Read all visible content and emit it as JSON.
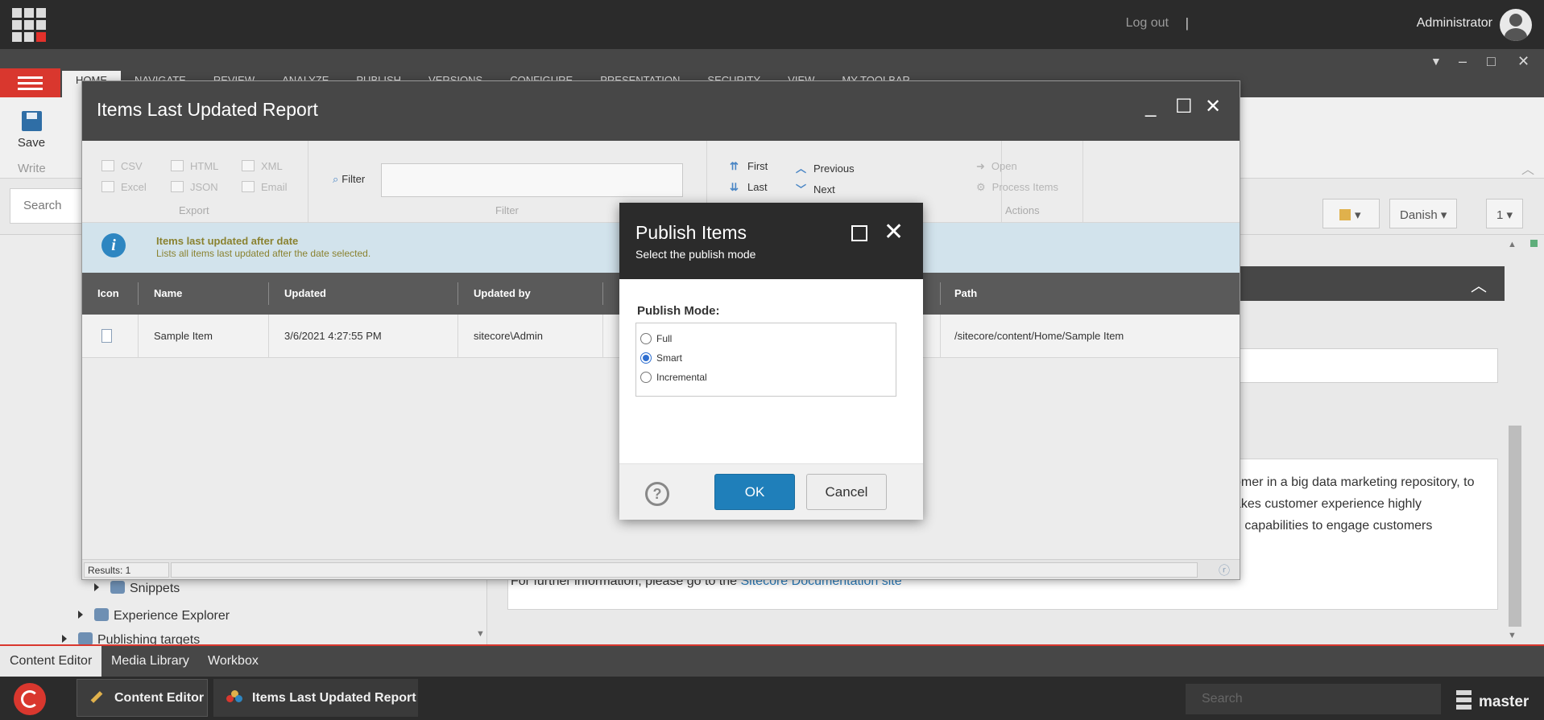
{
  "header": {
    "logout": "Log out",
    "separator": "|",
    "user": "Administrator"
  },
  "ribbon": {
    "tabs": [
      "HOME",
      "NAVIGATE",
      "REVIEW",
      "ANALYZE",
      "PUBLISH",
      "VERSIONS",
      "CONFIGURE",
      "PRESENTATION",
      "SECURITY",
      "VIEW",
      "MY TOOLBAR"
    ],
    "save_label": "Save",
    "write_label": "Write"
  },
  "search_row": {
    "search_placeholder": "Search",
    "language": "Danish",
    "version": "1"
  },
  "tree": {
    "items": [
      "Snippets",
      "Experience Explorer",
      "Publishing targets"
    ]
  },
  "content": {
    "line1": "omer in a big data marketing repository, to",
    "line2": "akes customer experience highly",
    "line3": "n capabilities to engage customers",
    "further_prefix": "For further information, please go to the",
    "link": "Sitecore Documentation site"
  },
  "bottom_tabs": [
    "Content Editor",
    "Media Library",
    "Workbox"
  ],
  "taskbar": {
    "tasks": [
      "Content Editor",
      "Items Last Updated Report"
    ],
    "search_placeholder": "Search",
    "database": "master"
  },
  "report": {
    "title": "Items Last Updated Report",
    "export": {
      "items": [
        "CSV",
        "HTML",
        "XML",
        "Excel",
        "JSON",
        "Email"
      ],
      "label": "Export"
    },
    "filter": {
      "label": "Filter",
      "group_label": "Filter",
      "value": ""
    },
    "navigation": {
      "first": "First",
      "previous": "Previous",
      "last": "Last",
      "next": "Next"
    },
    "actions": {
      "open": "Open",
      "process": "Process Items",
      "label": "Actions"
    },
    "info": {
      "title": "Items last updated after date",
      "description": "Lists all items last updated after the date selected."
    },
    "columns": [
      "Icon",
      "Name",
      "Updated",
      "Updated by",
      "Path"
    ],
    "rows": [
      {
        "name": "Sample Item",
        "updated": "3/6/2021 4:27:55 PM",
        "updated_by": "sitecore\\Admin",
        "path": "/sitecore/content/Home/Sample Item"
      }
    ],
    "status": "Results: 1"
  },
  "publish_dialog": {
    "title": "Publish Items",
    "subtitle": "Select the publish mode",
    "mode_label": "Publish Mode:",
    "modes": [
      "Full",
      "Smart",
      "Incremental"
    ],
    "selected_mode": "Smart",
    "ok": "OK",
    "cancel": "Cancel"
  }
}
